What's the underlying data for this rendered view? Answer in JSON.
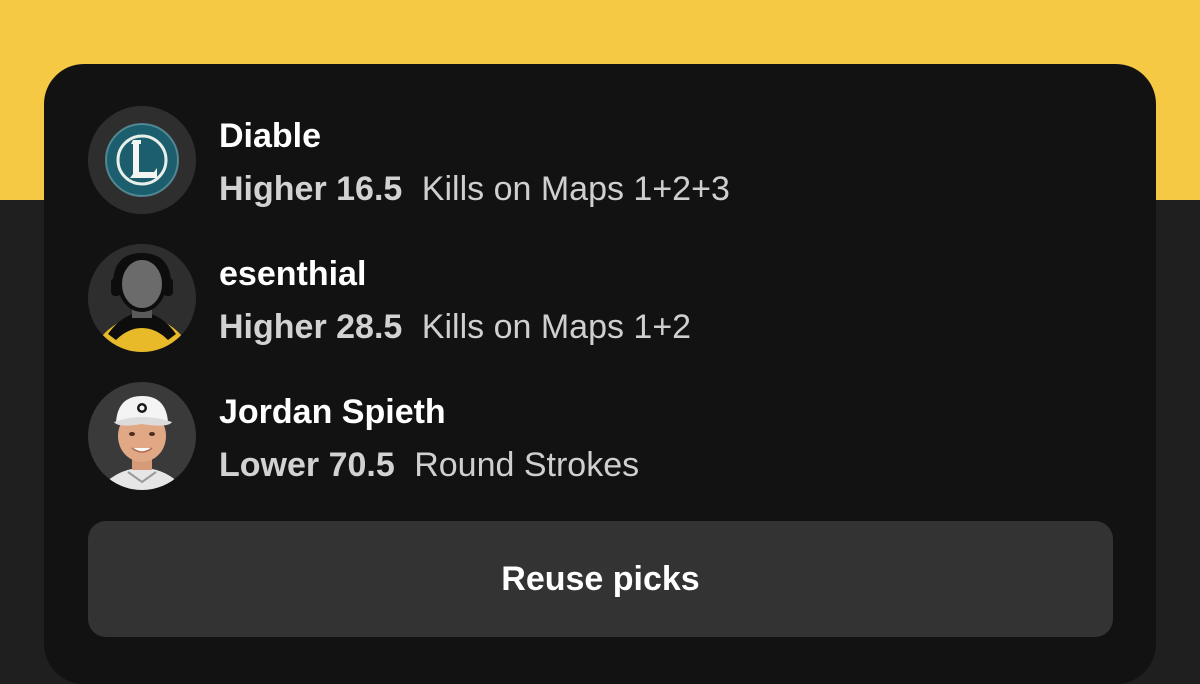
{
  "picks": [
    {
      "player": "Diable",
      "direction": "Higher",
      "line": "16.5",
      "stat": "Kills on Maps 1+2+3",
      "avatar_icon": "league-of-legends-logo-icon"
    },
    {
      "player": "esenthial",
      "direction": "Higher",
      "line": "28.5",
      "stat": "Kills on Maps 1+2",
      "avatar_icon": "esports-player-silhouette-icon"
    },
    {
      "player": "Jordan Spieth",
      "direction": "Lower",
      "line": "70.5",
      "stat": "Round Strokes",
      "avatar_icon": "golfer-photo-icon"
    }
  ],
  "reuse_button_label": "Reuse picks",
  "colors": {
    "accent_yellow": "#f6c945",
    "card_bg": "#121212",
    "page_bg": "#1f1f1f",
    "button_bg": "#333333"
  }
}
